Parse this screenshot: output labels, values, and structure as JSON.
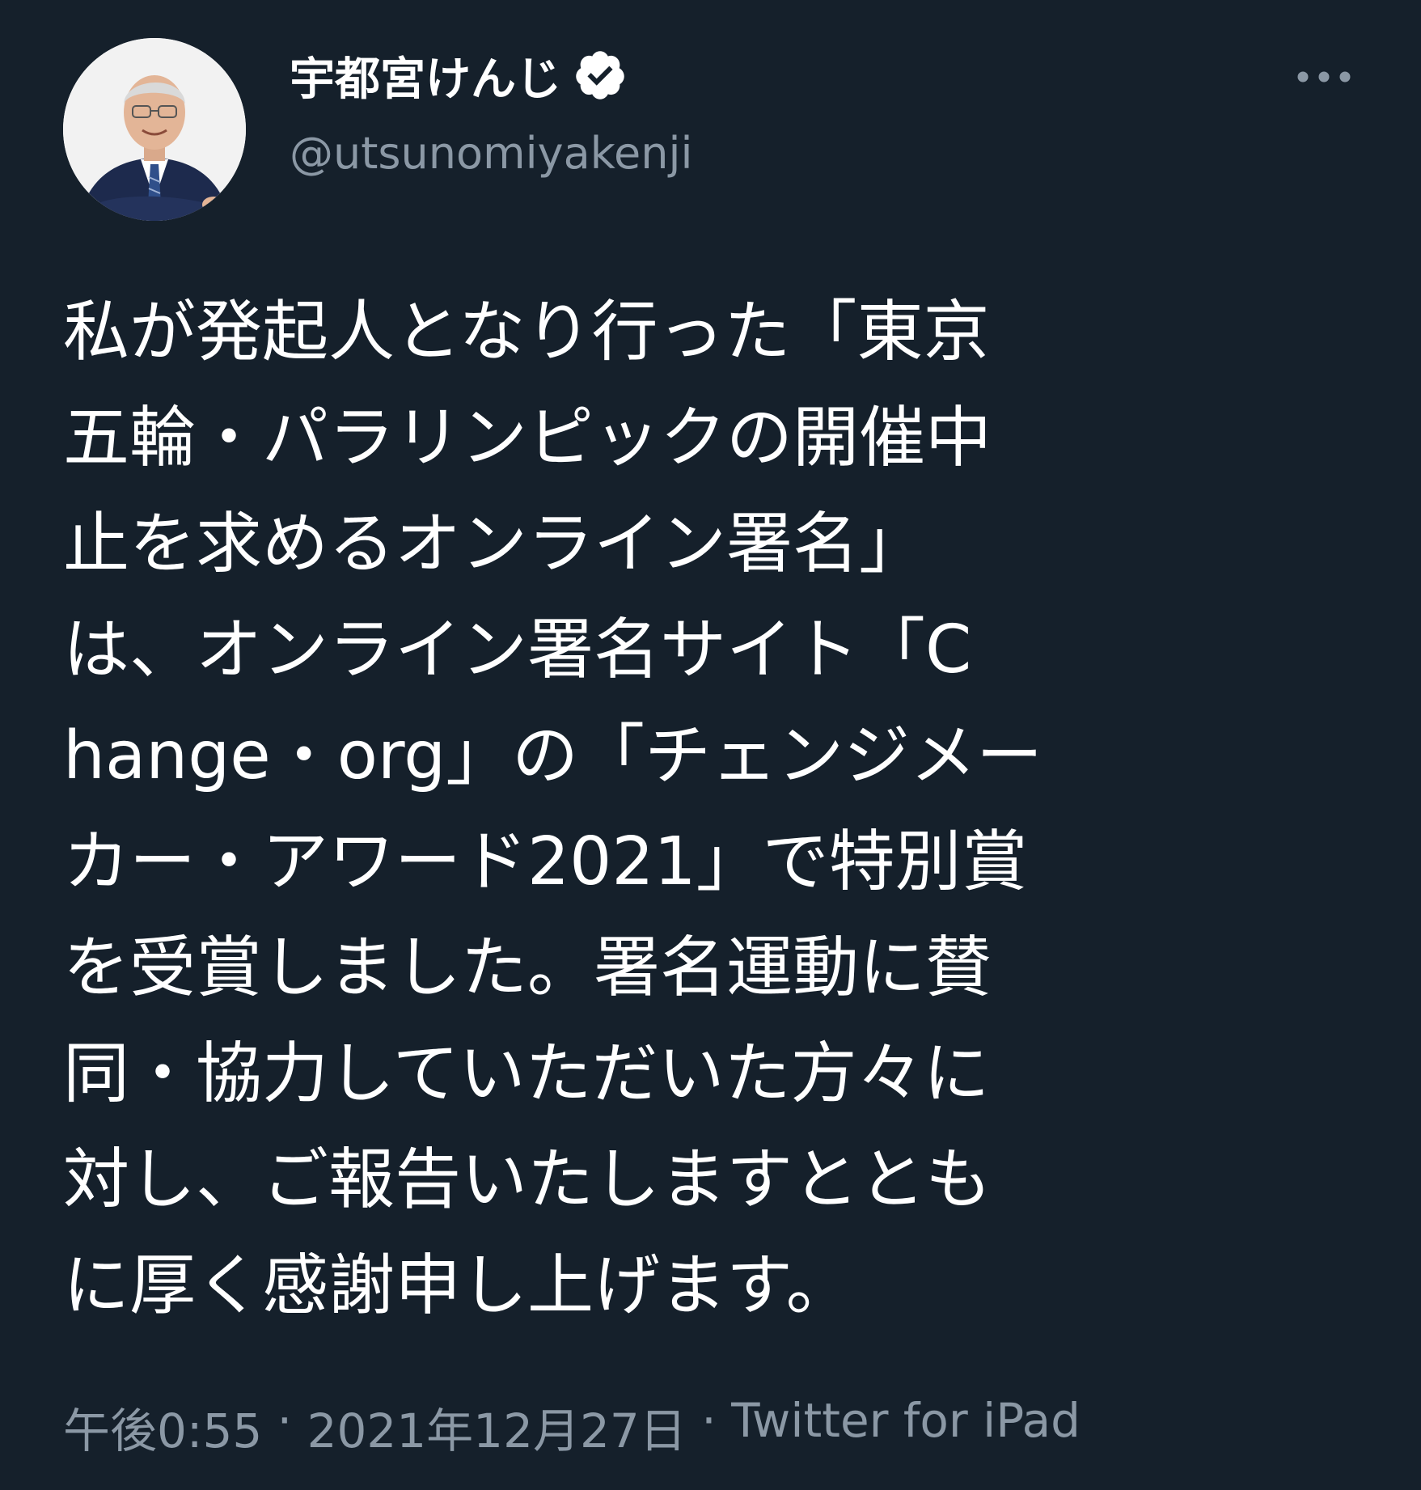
{
  "author": {
    "display_name": "宇都宮けんじ",
    "handle": "@utsunomiyakenji",
    "verified": true,
    "avatar_icon": "profile-photo"
  },
  "icons": {
    "verified": "verified-badge-icon",
    "more": "more-options-icon"
  },
  "tweet": {
    "text": "私が発起人となり行った「東京\n五輪・パラリンピックの開催中\n止を求めるオンライン署名」\nは、オンライン署名サイト「C\nhange・org」の「チェンジメー\nカー・アワード2021」で特別賞\nを受賞しました。署名運動に賛\n同・協力していただいた方々に\n対し、ご報告いたしますととも\nに厚く感謝申し上げます。"
  },
  "meta": {
    "time": "午後0:55",
    "separator": " · ",
    "date": "2021年12月27日",
    "source": "Twitter for iPad"
  },
  "colors": {
    "background": "#15202b",
    "text": "#ffffff",
    "secondary_text": "#8b98a5"
  }
}
